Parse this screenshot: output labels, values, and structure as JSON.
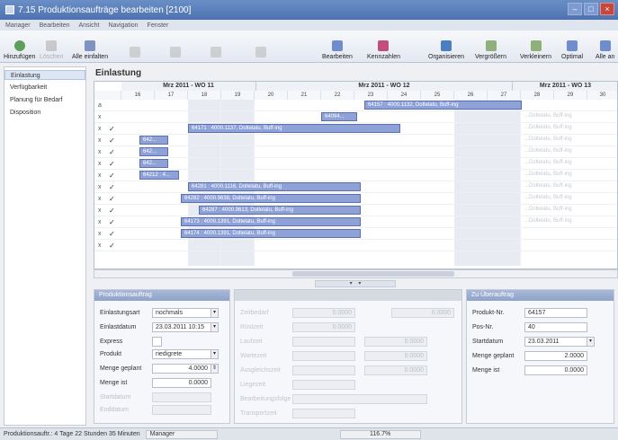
{
  "window": {
    "title": "7.15 Produktionsaufträge bearbeiten [2100]"
  },
  "menu": [
    "Manager",
    "Bearbeiten",
    "Ansicht",
    "Navigation",
    "Fenster"
  ],
  "toolbar": {
    "add": "Hinzufügen",
    "delete": "Löschen",
    "unfold_all": "Alle einfalten",
    "edit_product": "Bearbeiten",
    "capacities": "Kennzahlen",
    "organize": "Organisieren",
    "zoom_in": "Vergrößern",
    "zoom_out": "Verkleinern",
    "optimal": "Optimal",
    "all": "Alle an"
  },
  "sidebar": {
    "items": [
      {
        "label": "Einlastung",
        "active": true
      },
      {
        "label": "Verfügbarkeit",
        "active": false
      },
      {
        "label": "Planung für Bedarf",
        "active": false
      },
      {
        "label": "Disposition",
        "active": false
      }
    ]
  },
  "gantt": {
    "title": "Einlastung",
    "weeks": [
      "Mrz 2011 - WO 11",
      "Mrz 2011 - WO 12",
      "Mrz 2011 - WO 13"
    ],
    "days": [
      "16",
      "17",
      "18",
      "19",
      "20",
      "21",
      "22",
      "23",
      "24",
      "25",
      "26",
      "27",
      "28",
      "29",
      "30"
    ],
    "bars": [
      {
        "label": "64157 : 4000.1132, Doltelatu, Buff-ing"
      },
      {
        "label": "64094..."
      },
      {
        "label": "64171 : 4000.1137, Doltelatu, Buff-ing"
      },
      {
        "label": "642..."
      },
      {
        "label": "642..."
      },
      {
        "label": "642..."
      },
      {
        "label": "64212 : 4..."
      },
      {
        "label": "64281 : 4000.1116, Doltelatu, Buff-ing"
      },
      {
        "label": "64282 : 4000.9638, Doltelatu, Buff-ing"
      },
      {
        "label": "64287 : 4000.9613, Doltelatu, Buff-ing"
      },
      {
        "label": "64173 : 4000.1391, Doltelatu, Buff-ing"
      },
      {
        "label": "64174 : 4000.1391, Doltelatu, Buff-ing"
      }
    ],
    "ghost_labels": [
      "...Doltelatu, Buff-ing",
      "...Doltelatu, Buff-ing",
      "...Doltelatu, Buff-ing",
      "...Doltelatu, Buff-ing",
      "...Doltelatu, Buff-ing",
      "...Doltelatu, Buff-ing",
      "...Doltelatu, Buff-ing",
      "...Doltelatu, Buff-ing",
      "...Doltelatu, Buff-ing",
      "...Doltelatu, Buff-ing"
    ]
  },
  "left_panel": {
    "header": "Produktionsauftrag",
    "rows": [
      {
        "label": "Einlastungsart",
        "value": "nochmals"
      },
      {
        "label": "Einlastdatum",
        "value": "23.03.2011 10:15"
      },
      {
        "label": "Express",
        "value": ""
      },
      {
        "label": "Produkt",
        "value": "riedigrete"
      },
      {
        "label": "Menge geplant",
        "value": "4.0000"
      },
      {
        "label": "Menge ist",
        "value": "0.0000"
      },
      {
        "label": "Startdatum",
        "value": ""
      },
      {
        "label": "Enddatum",
        "value": ""
      }
    ]
  },
  "middle_panel": {
    "rows": [
      {
        "label": "Zeitbedarf",
        "value": "0.0000",
        "value2": "0.0000"
      },
      {
        "label": "Rüstzeit",
        "value": "0.0000"
      },
      {
        "label": "Laufzeit",
        "value": "",
        "value2": "0.0000"
      },
      {
        "label": "Wartezeit",
        "value": "",
        "value2": "0.0000"
      },
      {
        "label": "Ausgleichszeit",
        "value": "",
        "value2": "0.0000"
      },
      {
        "label": "Liegezeit",
        "value": ""
      },
      {
        "label": "Bearbeitungsfolge",
        "value": ""
      },
      {
        "label": "Transportzeit",
        "value": ""
      }
    ]
  },
  "right_panel": {
    "header": "Zu Überauftrag",
    "rows": [
      {
        "label": "Produkt-Nr.",
        "value": "64157"
      },
      {
        "label": "Pos-Nr.",
        "value": "40"
      },
      {
        "label": "Startdatum",
        "value": "23.03.2011"
      },
      {
        "label": "Menge geplant",
        "value": "2.0000"
      },
      {
        "label": "Menge ist",
        "value": "0.0000"
      }
    ]
  },
  "status": {
    "text": "Produktionsauftr.: 4 Tage 22 Stunden 35 Minuten",
    "user": "Manager",
    "zoom": "116.7%"
  }
}
